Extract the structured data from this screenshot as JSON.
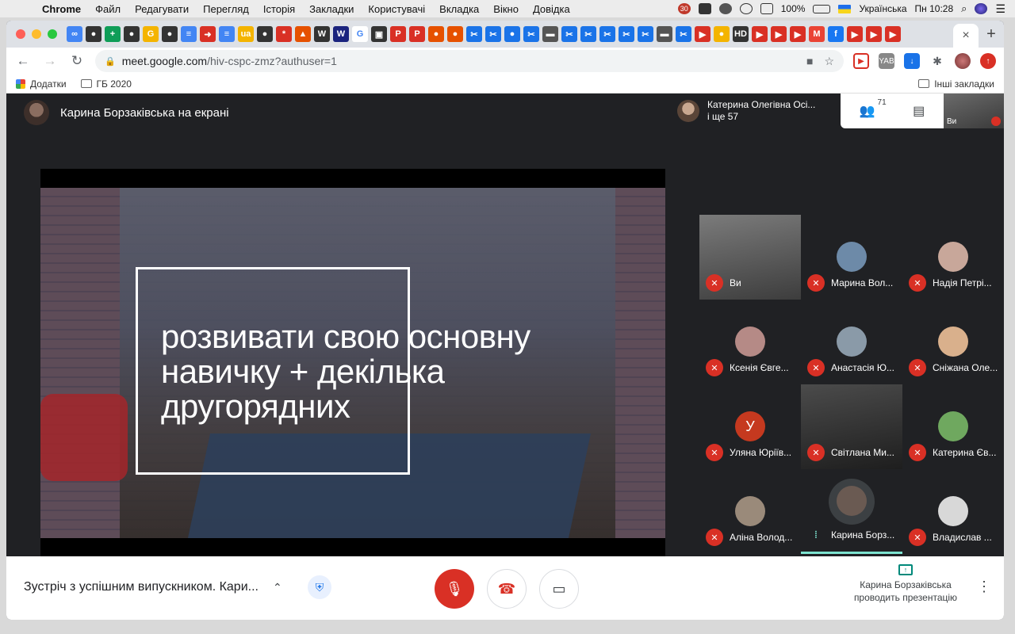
{
  "menubar": {
    "app": "Chrome",
    "items": [
      "Файл",
      "Редагувати",
      "Перегляд",
      "Історія",
      "Закладки",
      "Користувачі",
      "Вкладка",
      "Вікно",
      "Довідка"
    ],
    "badge": "30",
    "battery": "100%",
    "keyboard": "Українська",
    "clock": "Пн 10:28"
  },
  "browser": {
    "tab_icon_labels": [
      "∞",
      "●",
      "+",
      "●",
      "G",
      "●",
      "≡",
      "➜",
      "≡",
      "ua",
      "●",
      "*",
      "▲",
      "W",
      "W",
      "G",
      "▣",
      "P",
      "P",
      "●",
      "●",
      "✂",
      "✂",
      "●",
      "✂",
      "▬",
      "✂",
      "✂",
      "✂",
      "✂",
      "✂",
      "▬",
      "✂",
      "▶",
      "●",
      "HD",
      "▶",
      "▶",
      "▶",
      "M",
      "f",
      "▶",
      "▶",
      "▶"
    ],
    "active_tab_close": "×",
    "new_tab": "+",
    "url_host": "meet.google.com",
    "url_path": "/hiv-cspc-zmz?authuser=1",
    "bookmarks": {
      "apps": "Додатки",
      "folder1": "ГБ 2020",
      "other": "Інші закладки"
    }
  },
  "meet": {
    "presenter_header": "Карина Борзаківська на екрані",
    "participants_summary_line1": "Катерина Олегівна Осі...",
    "participants_summary_line2": "і ще 57",
    "people_count": "71",
    "self_mini_label": "Ви",
    "slide_text": "розвивати свою основну навичку + декілька другорядних",
    "tiles": [
      {
        "name": "Ви",
        "kind": "video",
        "mic": "muted"
      },
      {
        "name": "Марина Вол...",
        "kind": "avatar",
        "color": "#6d8aa8",
        "mic": "muted"
      },
      {
        "name": "Надія Петрі...",
        "kind": "avatar",
        "color": "#c8a79a",
        "mic": "muted"
      },
      {
        "name": "Ксенія Євге...",
        "kind": "avatar",
        "color": "#b58a86",
        "mic": "muted"
      },
      {
        "name": "Анастасія Ю...",
        "kind": "avatar",
        "color": "#8a9aa8",
        "mic": "muted"
      },
      {
        "name": "Сніжана Оле...",
        "kind": "avatar",
        "color": "#d9b08c",
        "mic": "muted"
      },
      {
        "name": "Уляна Юріїв...",
        "kind": "letter",
        "letter": "У",
        "color": "#c5391f",
        "mic": "muted"
      },
      {
        "name": "Світлана Ми...",
        "kind": "video2",
        "mic": "muted"
      },
      {
        "name": "Катерина Єв...",
        "kind": "avatar",
        "color": "#6fa85f",
        "mic": "muted"
      },
      {
        "name": "Аліна Волод...",
        "kind": "avatar",
        "color": "#9a8a7a",
        "mic": "muted"
      },
      {
        "name": "Карина Борз...",
        "kind": "speaking",
        "color": "#6a5a52",
        "mic": "speaking"
      },
      {
        "name": "Владислав ...",
        "kind": "avatar",
        "color": "#d8d8d8",
        "mic": "muted"
      }
    ]
  },
  "bottom": {
    "meeting_title": "Зустріч з успішним випускником. Кари...",
    "presenting_line1": "Карина Борзаківська",
    "presenting_line2": "проводить презентацію"
  },
  "icons": {
    "apple": "",
    "back": "←",
    "forward": "→",
    "reload": "↻",
    "lock": "🔒",
    "star": "☆",
    "camera": "■",
    "people": "👥",
    "chat": "▤",
    "mic_off": "🎙",
    "hangup": "☎",
    "cam": "▭",
    "chevron": "⌃",
    "shield": "⛨",
    "more": "⋮",
    "present": "↑"
  }
}
